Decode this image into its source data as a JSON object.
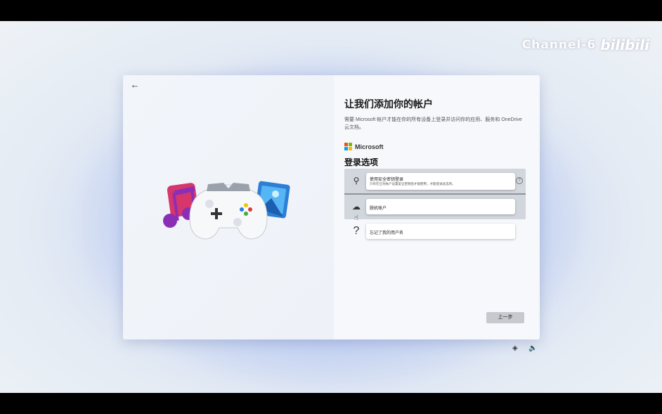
{
  "watermark": {
    "channel": "Channel-6",
    "brand": "bilibili"
  },
  "dialog": {
    "back_icon": "arrow-left-icon",
    "title": "让我们添加你的帐户",
    "description": "需要 Microsoft 帐户才能在你的所有设备上登录并访问你的应用、服务和 OneDrive 云文档。",
    "logo_text": "Microsoft",
    "logo_colors": [
      "#f25022",
      "#7fba00",
      "#00a4ef",
      "#ffb900"
    ],
    "section_title": "登录选项",
    "options": [
      {
        "title": "使用安全密钥登录",
        "detail": "只有在已为帐户设置安全密钥后才能使用，才能登录此选项。",
        "icon": "security-key-icon"
      },
      {
        "title": "脱机帐户",
        "detail": "",
        "icon": "cloud-offline-icon"
      },
      {
        "title": "忘记了我的用户名",
        "detail": "",
        "icon": "question-icon"
      }
    ],
    "back_button": "上一步"
  },
  "tray": {
    "network_icon": "network-icon",
    "volume_icon": "volume-icon"
  }
}
